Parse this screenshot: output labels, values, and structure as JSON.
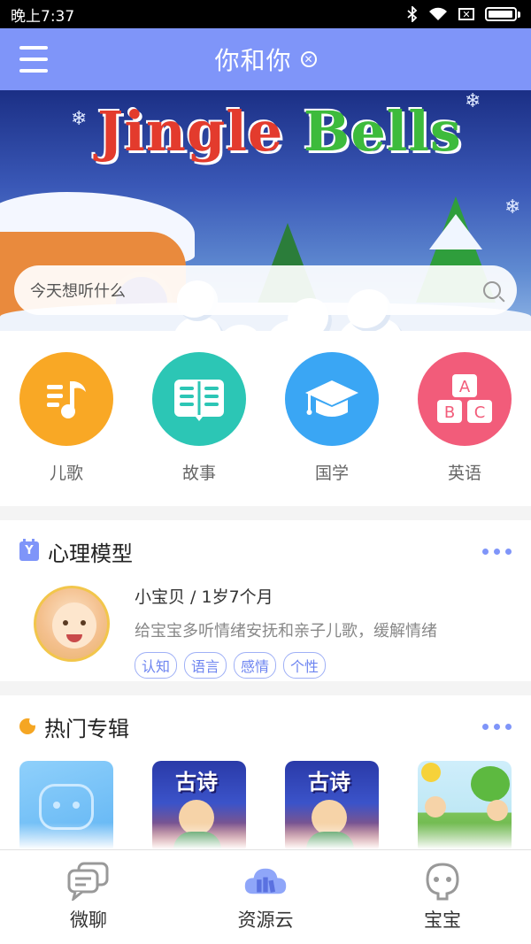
{
  "status": {
    "time": "晚上7:37"
  },
  "header": {
    "title": "你和你"
  },
  "banner": {
    "title_part1": "Jingle",
    "title_part2": "Bells"
  },
  "search": {
    "placeholder": "今天想听什么"
  },
  "categories": [
    {
      "label": "儿歌",
      "color": "#f9a825",
      "icon": "music-note-icon"
    },
    {
      "label": "故事",
      "color": "#2cc6b5",
      "icon": "open-book-icon"
    },
    {
      "label": "国学",
      "color": "#3aa6f4",
      "icon": "graduation-cap-icon"
    },
    {
      "label": "英语",
      "color": "#f25c7a",
      "icon": "abc-blocks-icon"
    }
  ],
  "psych_section": {
    "title": "心理模型",
    "name_age": "小宝贝 / 1岁7个月",
    "description": "给宝宝多听情绪安抚和亲子儿歌，缓解情绪",
    "tags": [
      "认知",
      "语言",
      "感情",
      "个性"
    ]
  },
  "hot_section": {
    "title": "热门专辑",
    "albums": [
      {
        "cover": "robot"
      },
      {
        "cover": "poem",
        "label": "古诗"
      },
      {
        "cover": "poem",
        "label": "古诗"
      },
      {
        "cover": "outdoor"
      }
    ]
  },
  "bottom_nav": [
    {
      "label": "微聊",
      "icon": "chat-bubbles-icon"
    },
    {
      "label": "资源云",
      "icon": "cloud-books-icon"
    },
    {
      "label": "宝宝",
      "icon": "baby-face-icon"
    }
  ],
  "colors": {
    "accent": "#7f95f9",
    "tag_text": "#6d84f0"
  }
}
